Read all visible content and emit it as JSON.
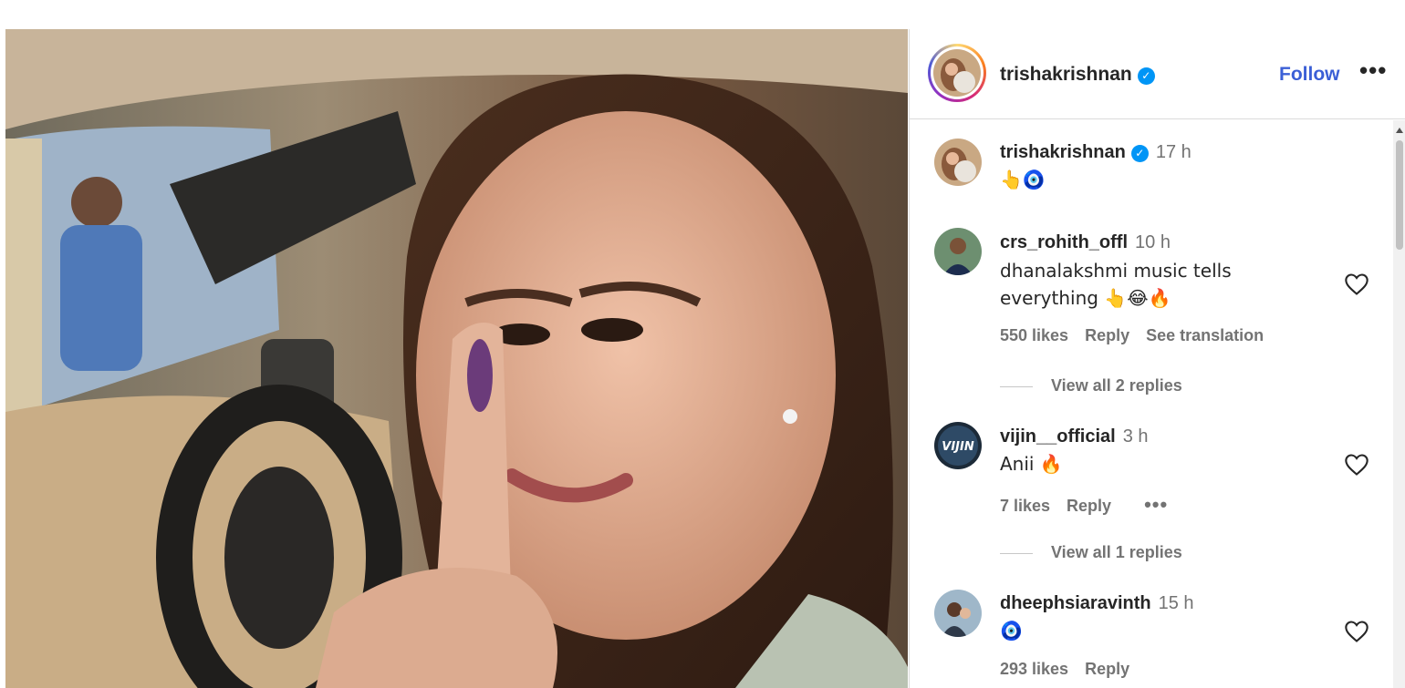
{
  "post": {
    "author": "trishakrishnan",
    "follow_label": "Follow",
    "more_label": "•••",
    "verified_mark": "✓"
  },
  "caption": {
    "user": "trishakrishnan",
    "time": "17 h",
    "text": "👆🧿"
  },
  "comments": [
    {
      "user": "crs_rohith_offl",
      "time": "10 h",
      "text": "dhanalakshmi music tells everything 👆😂🔥",
      "likes": "550 likes",
      "reply_label": "Reply",
      "extra": "See translation",
      "view_replies": "View all 2 replies"
    },
    {
      "user": "vijin__official",
      "time": "3 h",
      "text": "Anii 🔥",
      "likes": "7 likes",
      "reply_label": "Reply",
      "extra": "•••",
      "view_replies": "View all 1 replies",
      "avatar_text": "VIJIN"
    },
    {
      "user": "dheephsiaravinth",
      "time": "15 h",
      "text": "🧿",
      "likes": "293 likes",
      "reply_label": "Reply"
    }
  ],
  "colors": {
    "follow_blue": "#3b5fd6",
    "verified_blue": "#0095f6",
    "muted_text": "#737373",
    "divider": "#dbdbdb"
  },
  "icons": [
    "verified-badge-icon",
    "more-options-icon",
    "heart-icon",
    "scroll-up-arrow-icon"
  ]
}
